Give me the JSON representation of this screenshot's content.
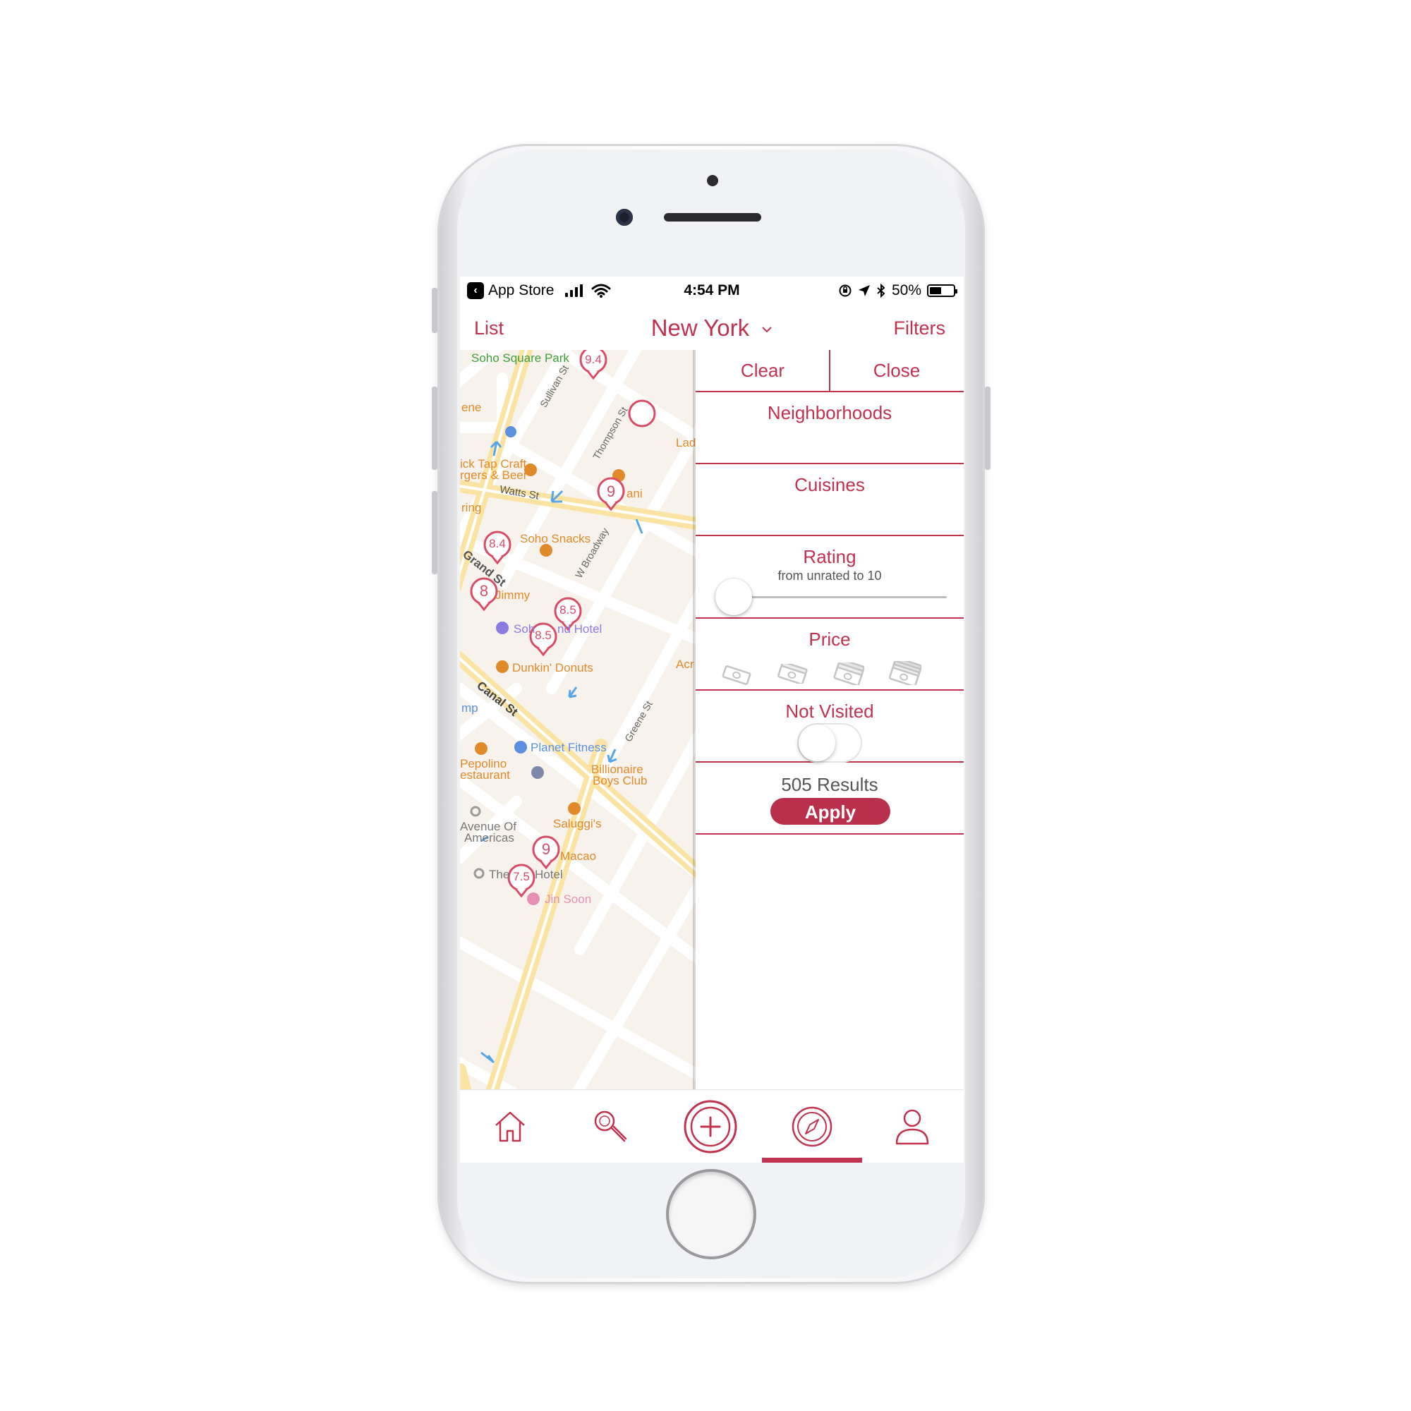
{
  "status_bar": {
    "back_app": "App Store",
    "time": "4:54 PM",
    "battery_percent": "50%",
    "battery_level": 0.5
  },
  "nav": {
    "left": "List",
    "title": "New York",
    "right": "Filters"
  },
  "map": {
    "labels": {
      "soho_square_park": "Soho Square Park",
      "ene": "ene",
      "lad": "Lad",
      "black_tap_1": "ick Tap Craft",
      "black_tap_2": "rgers & Beer",
      "watts_st": "Watts St",
      "ani": "ani",
      "ring": "ring",
      "sullivan_st": "Sullivan St",
      "thompson_st": "Thompson St",
      "soho_snacks": "Soho Snacks",
      "grand_st": "Grand St",
      "w_broadway": "W Broadway",
      "jimmy": "Jimmy",
      "soho_grand_hotel_1": "Soh",
      "soho_grand_hotel_2": "nd Hotel",
      "dunkin": "Dunkin' Donuts",
      "acr": "Acr",
      "canal_st": "Canal St",
      "mp": "mp",
      "greene_st": "Greene St",
      "planet_fitness": "Planet Fitness",
      "pepolino_1": "Pepolino",
      "pepolino_2": "estaurant",
      "billionaire_1": "Billionaire",
      "billionaire_2": "Boys Club",
      "saluggis": "Saluggi's",
      "avenue_1": "Avenue Of",
      "avenue_2": "Americas",
      "macao": "Macao",
      "the_hotel_1": "The",
      "the_hotel_2": "Hotel",
      "jin_soon": "Jin Soon"
    },
    "pins": [
      "9.4",
      "9",
      "8.4",
      "8",
      "8.5",
      "8.5",
      "9",
      "7.5"
    ],
    "colors": {
      "land": "#f7f3ec",
      "street": "#ffffff",
      "major_road": "#fbe4a3",
      "pin": "#d94c68",
      "poi_food": "#e08a2b",
      "park_text": "#3f9e3a",
      "hotel": "#8b7be0",
      "gym": "#5b8fe0"
    }
  },
  "filter_panel": {
    "clear": "Clear",
    "close": "Close",
    "neighborhoods": "Neighborhoods",
    "cuisines": "Cuisines",
    "rating": "Rating",
    "rating_sub": "from unrated to 10",
    "rating_slider_value": 0,
    "price": "Price",
    "price_icons": [
      "money-1-icon",
      "money-2-icon",
      "money-3-icon",
      "money-4-icon"
    ],
    "not_visited": "Not Visited",
    "not_visited_on": false,
    "results": "505 Results",
    "apply": "Apply"
  },
  "tab_bar": {
    "tabs": [
      "home-icon",
      "search-icon",
      "add-icon",
      "compass-icon",
      "profile-icon"
    ],
    "active_index": 3
  },
  "accent": "#c0334f"
}
